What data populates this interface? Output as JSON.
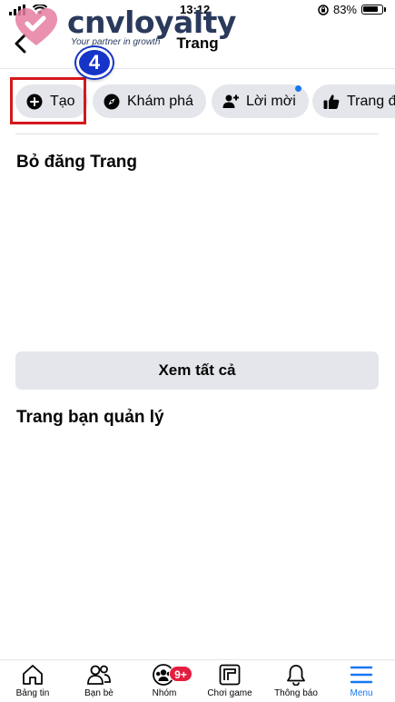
{
  "status_bar": {
    "time": "13:12",
    "battery": "83%"
  },
  "header": {
    "title": "Trang",
    "back_icon": "chevron-left-icon"
  },
  "watermark": {
    "name": "cnvloyalty",
    "tagline": "Your partner in growth",
    "step_number": "4"
  },
  "chips": [
    {
      "label": "Tạo",
      "icon": "plus-circle-icon"
    },
    {
      "label": "Khám phá",
      "icon": "compass-icon"
    },
    {
      "label": "Lời mời",
      "icon": "add-person-icon"
    },
    {
      "label": "Trang đ",
      "icon": "thumbs-up-icon"
    }
  ],
  "sections": {
    "unpublished_title": "Bỏ đăng Trang",
    "see_all_label": "Xem tất cả",
    "managed_title": "Trang bạn quản lý"
  },
  "tabbar": {
    "items": [
      {
        "label": "Bảng tin",
        "icon": "home-icon"
      },
      {
        "label": "Bạn bè",
        "icon": "friends-icon"
      },
      {
        "label": "Nhóm",
        "icon": "groups-icon",
        "badge": "9+"
      },
      {
        "label": "Chơi game",
        "icon": "gaming-icon"
      },
      {
        "label": "Thông báo",
        "icon": "bell-icon"
      },
      {
        "label": "Menu",
        "icon": "menu-icon",
        "active": true
      }
    ]
  },
  "colors": {
    "accent": "#1877f2",
    "chip_bg": "#e4e6eb",
    "highlight": "#d4181c",
    "badge_bg": "#e41e3f",
    "logo_heart": "#e57ea1",
    "logo_text": "#2a3a5c",
    "step_badge": "#1634c8"
  }
}
